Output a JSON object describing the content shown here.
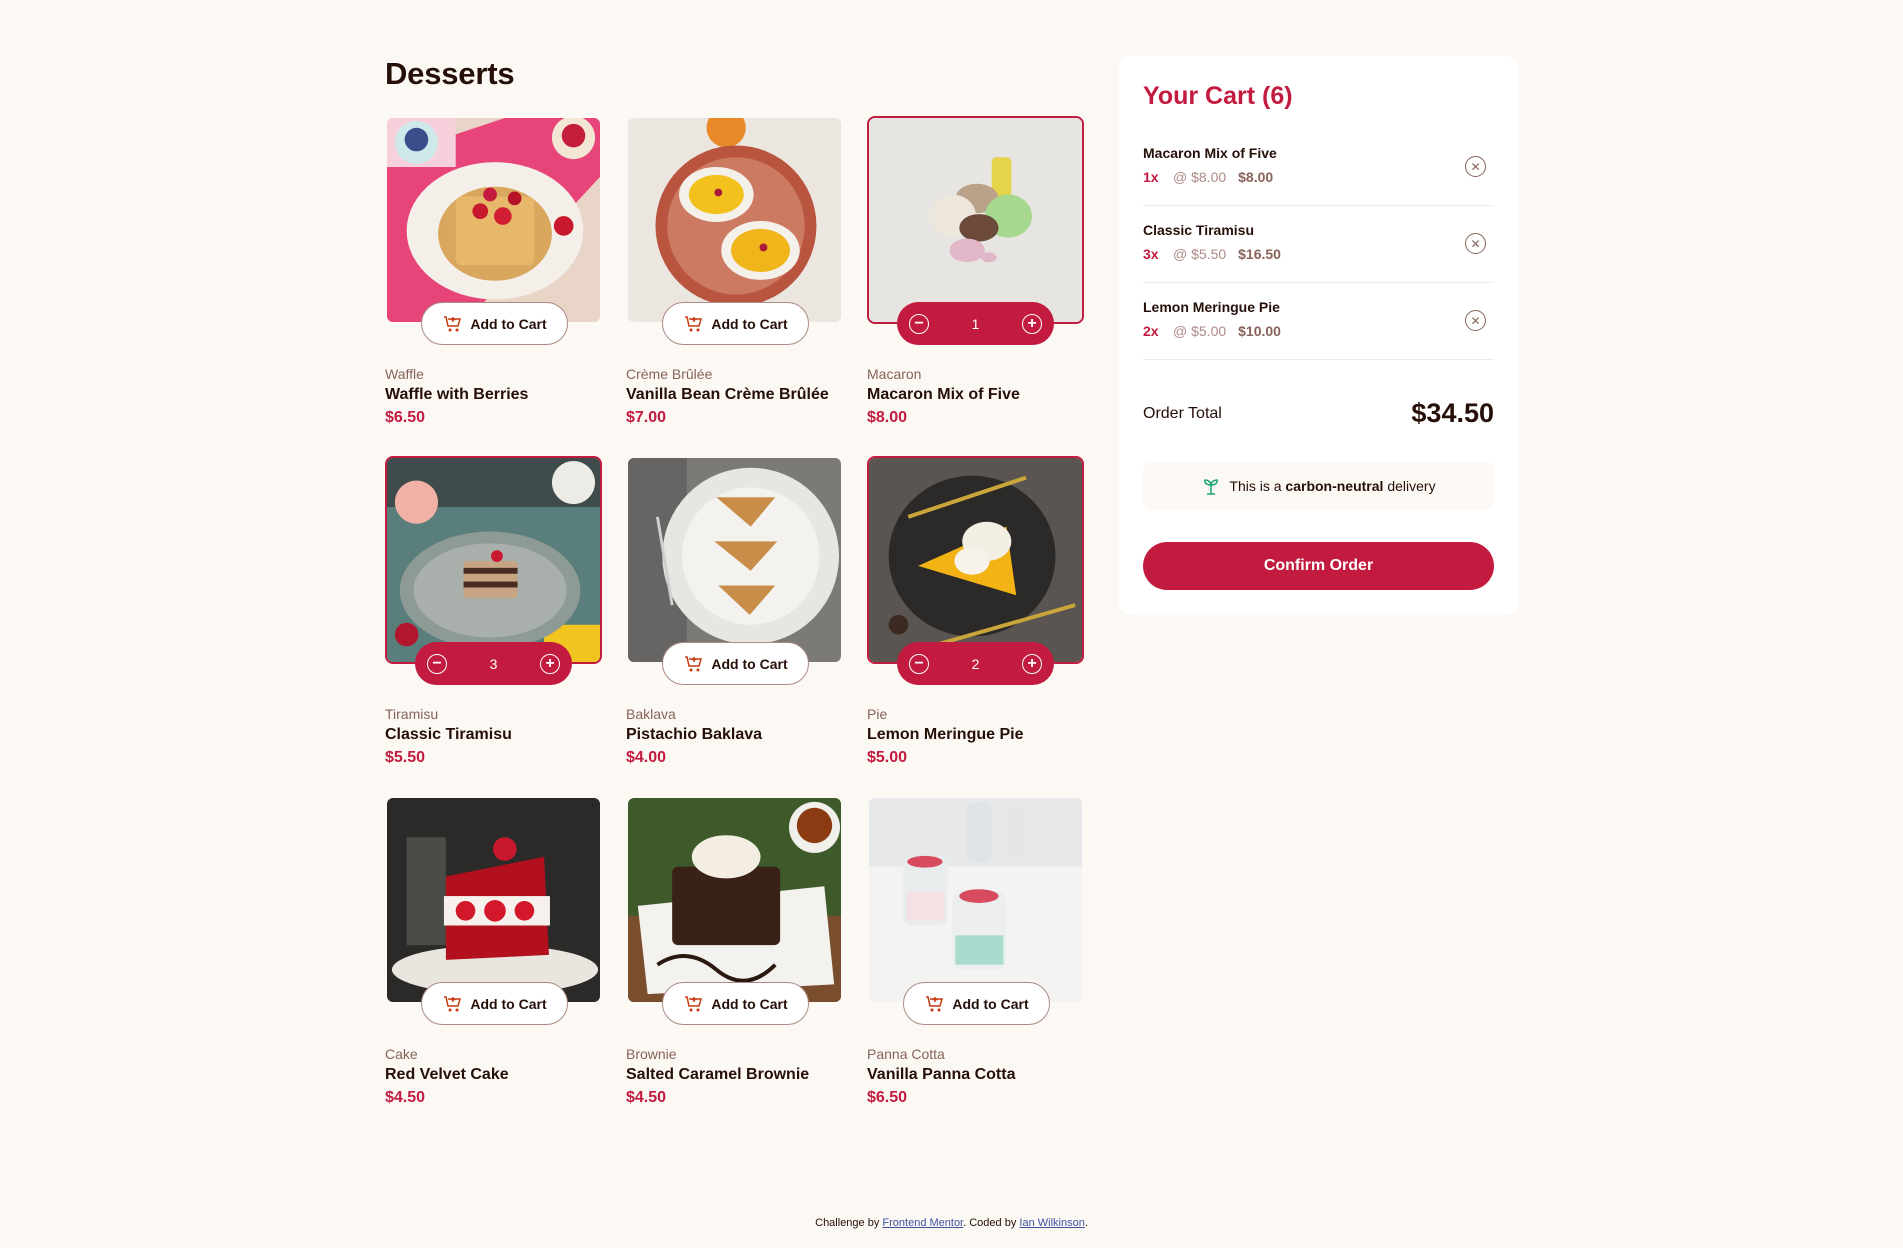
{
  "page": {
    "title": "Desserts"
  },
  "actions": {
    "add_to_cart": "Add to Cart"
  },
  "products": [
    {
      "category": "Waffle",
      "name": "Waffle with Berries",
      "price": "$6.50",
      "in_cart": false,
      "quantity": ""
    },
    {
      "category": "Crème Brûlée",
      "name": "Vanilla Bean Crème Brûlée",
      "price": "$7.00",
      "in_cart": false,
      "quantity": ""
    },
    {
      "category": "Macaron",
      "name": "Macaron Mix of Five",
      "price": "$8.00",
      "in_cart": true,
      "quantity": "1"
    },
    {
      "category": "Tiramisu",
      "name": "Classic Tiramisu",
      "price": "$5.50",
      "in_cart": true,
      "quantity": "3"
    },
    {
      "category": "Baklava",
      "name": "Pistachio Baklava",
      "price": "$4.00",
      "in_cart": false,
      "quantity": ""
    },
    {
      "category": "Pie",
      "name": "Lemon Meringue Pie",
      "price": "$5.00",
      "in_cart": true,
      "quantity": "2"
    },
    {
      "category": "Cake",
      "name": "Red Velvet Cake",
      "price": "$4.50",
      "in_cart": false,
      "quantity": ""
    },
    {
      "category": "Brownie",
      "name": "Salted Caramel Brownie",
      "price": "$4.50",
      "in_cart": false,
      "quantity": ""
    },
    {
      "category": "Panna Cotta",
      "name": "Vanilla Panna Cotta",
      "price": "$6.50",
      "in_cart": false,
      "quantity": ""
    }
  ],
  "cart": {
    "title": "Your Cart (6)",
    "items": [
      {
        "name": "Macaron Mix of Five",
        "qty": "1x",
        "unit": "@ $8.00",
        "total": "$8.00"
      },
      {
        "name": "Classic Tiramisu",
        "qty": "3x",
        "unit": "@ $5.50",
        "total": "$16.50"
      },
      {
        "name": "Lemon Meringue Pie",
        "qty": "2x",
        "unit": "@ $5.00",
        "total": "$10.00"
      }
    ],
    "total_label": "Order Total",
    "total_value": "$34.50",
    "neutral_prefix": "This is a",
    "neutral_bold": "carbon-neutral",
    "neutral_suffix": "delivery",
    "confirm_label": "Confirm Order"
  },
  "footer": {
    "prefix": "Challenge by",
    "link1": "Frontend Mentor",
    "middle": ". Coded by",
    "link2": "Ian Wilkinson",
    "suffix": "."
  },
  "colors": {
    "accent": "#c31b3f",
    "background": "#fcf8f4",
    "neutral_icon": "#1ea475"
  }
}
